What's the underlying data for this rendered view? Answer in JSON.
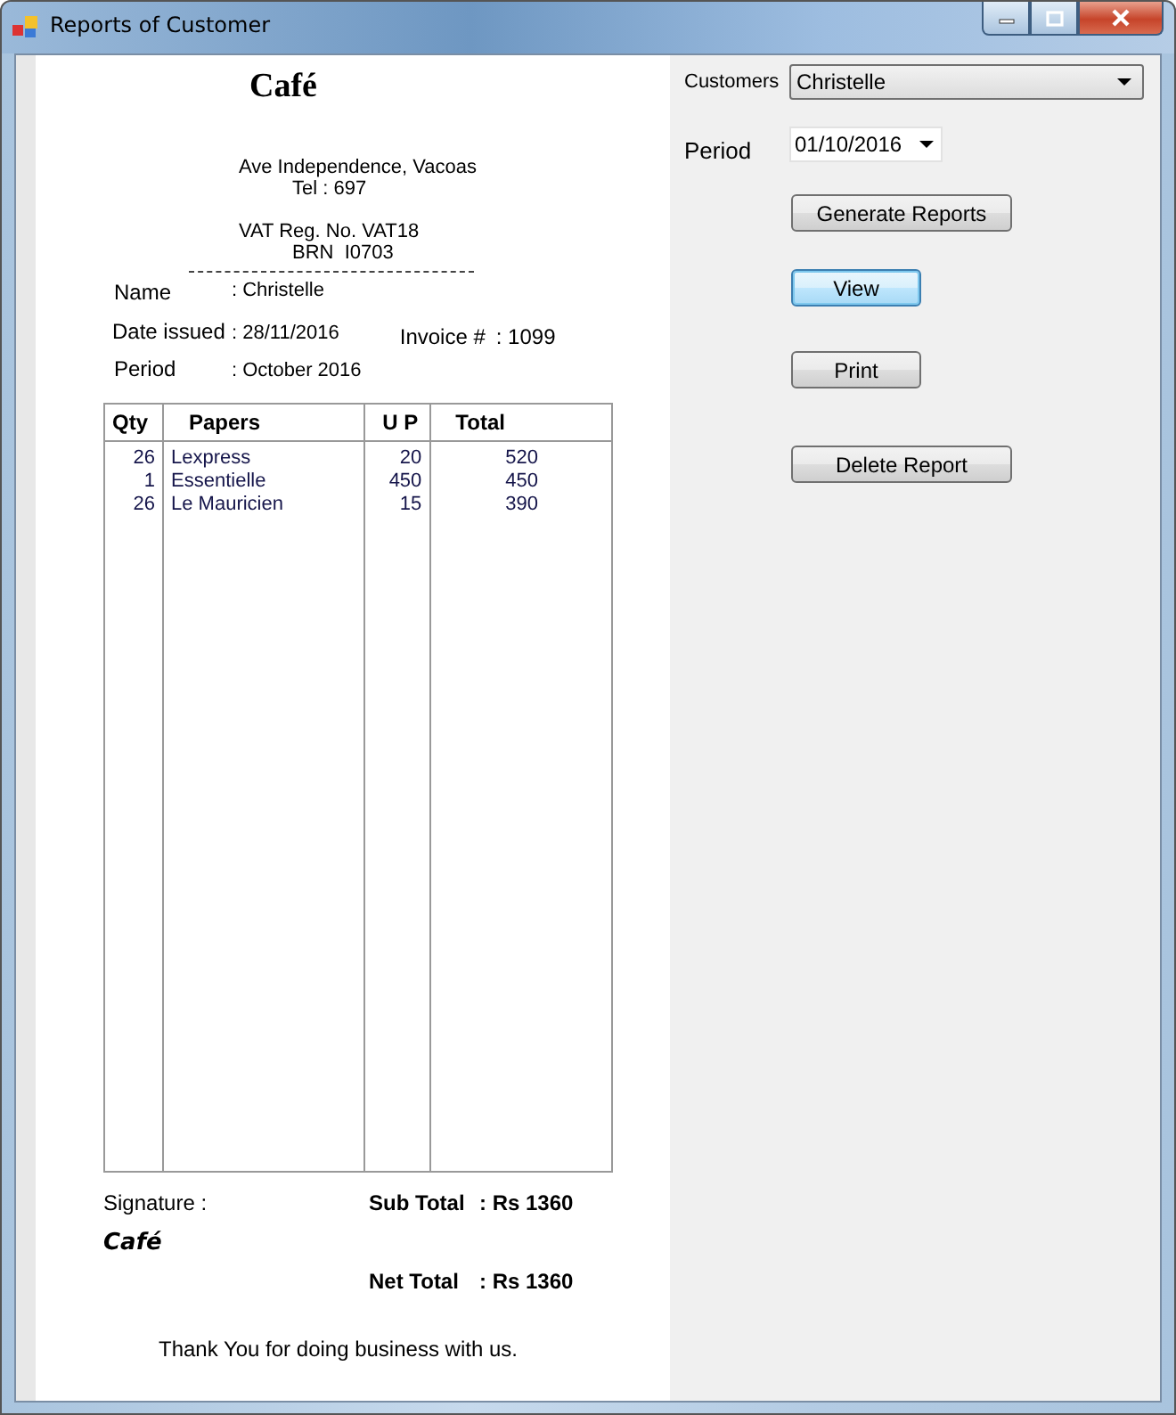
{
  "window": {
    "title": "Reports of Customer"
  },
  "report": {
    "shop_name": "Café",
    "address": "Ave Independence, Vacoas",
    "tel": "Tel : 697",
    "vat": "VAT Reg. No. VAT18",
    "brn": "BRN  I0703",
    "name_label": "Name",
    "name_value": ": Christelle",
    "date_label": "Date issued",
    "date_value": ": 28/11/2016",
    "invoice_label": "Invoice #",
    "invoice_value": ": 1099",
    "period_label": "Period",
    "period_value": ": October 2016",
    "table": {
      "columns": [
        "Qty",
        "Papers",
        "U P",
        "Total"
      ],
      "rows": [
        [
          "26",
          "Lexpress",
          "20",
          "520"
        ],
        [
          "1",
          "Essentielle",
          "450",
          "450"
        ],
        [
          "26",
          "Le Mauricien",
          "15",
          "390"
        ]
      ]
    },
    "signature_label": "Signature :",
    "signature": "Café",
    "subtotal_label": "Sub Total",
    "subtotal_value": ": Rs 1360",
    "nettotal_label": "Net Total",
    "nettotal_value": ": Rs 1360",
    "footer": "Thank You for doing business with us."
  },
  "controls": {
    "customers_label": "Customers",
    "customer": "Christelle",
    "period_label": "Period",
    "period": "01/10/2016",
    "buttons": [
      {
        "label": "Generate Reports",
        "focused": false
      },
      {
        "label": "View",
        "focused": true
      },
      {
        "label": "Print",
        "focused": false
      },
      {
        "label": "Delete Report",
        "focused": false
      }
    ]
  }
}
